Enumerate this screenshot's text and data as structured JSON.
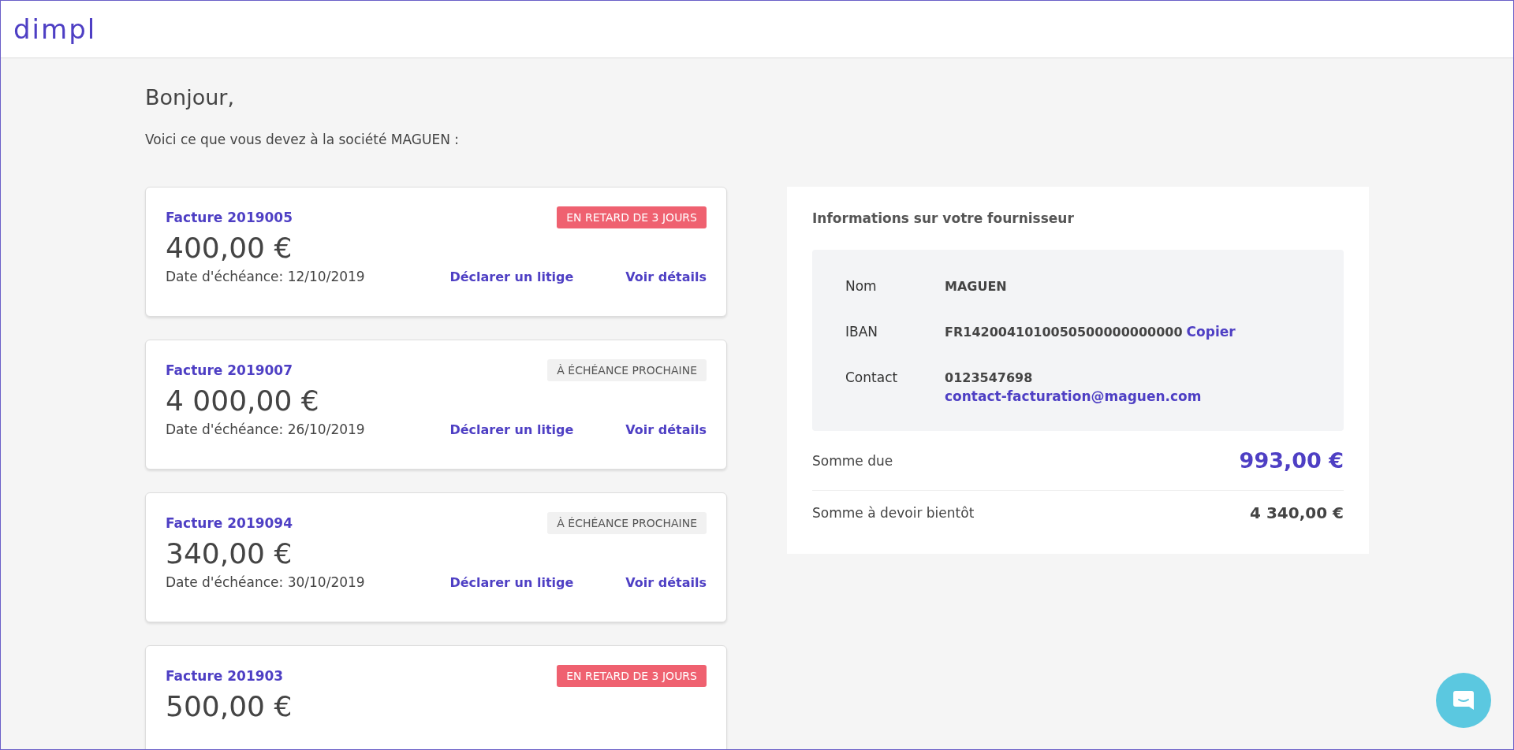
{
  "header": {
    "logo": "dimpl"
  },
  "greeting": "Bonjour,",
  "intro": "Voici ce que vous devez à la société MAGUEN :",
  "invoices": [
    {
      "title": "Facture 2019005",
      "status": {
        "kind": "overdue",
        "label": "EN RETARD DE 3 JOURS"
      },
      "amount": "400,00 €",
      "due_date": "Date d'échéance: 12/10/2019",
      "dispute_link": "Déclarer un litige",
      "details_link": "Voir détails"
    },
    {
      "title": "Facture 2019007",
      "status": {
        "kind": "upcoming",
        "label": "À ÉCHÉANCE PROCHAINE"
      },
      "amount": "4 000,00 €",
      "due_date": "Date d'échéance: 26/10/2019",
      "dispute_link": "Déclarer un litige",
      "details_link": "Voir détails"
    },
    {
      "title": "Facture 2019094",
      "status": {
        "kind": "upcoming",
        "label": "À ÉCHÉANCE PROCHAINE"
      },
      "amount": "340,00 €",
      "due_date": "Date d'échéance: 30/10/2019",
      "dispute_link": "Déclarer un litige",
      "details_link": "Voir détails"
    },
    {
      "title": "Facture 201903",
      "status": {
        "kind": "overdue",
        "label": "EN RETARD DE 3 JOURS"
      },
      "amount": "500,00 €"
    }
  ],
  "supplier": {
    "title": "Informations sur votre fournisseur",
    "fields": [
      {
        "label": "Nom",
        "value": "MAGUEN"
      },
      {
        "label": "IBAN",
        "value": "FR1420041010050500000000000",
        "action": "Copier"
      },
      {
        "label": "Contact",
        "value": "0123547698",
        "email": "contact-facturation@maguen.com"
      }
    ],
    "totals": [
      {
        "label": "Somme due",
        "value": "993,00 €",
        "highlight": true
      },
      {
        "label": "Somme à devoir bientôt",
        "value": "4 340,00 €",
        "highlight": false
      }
    ]
  }
}
